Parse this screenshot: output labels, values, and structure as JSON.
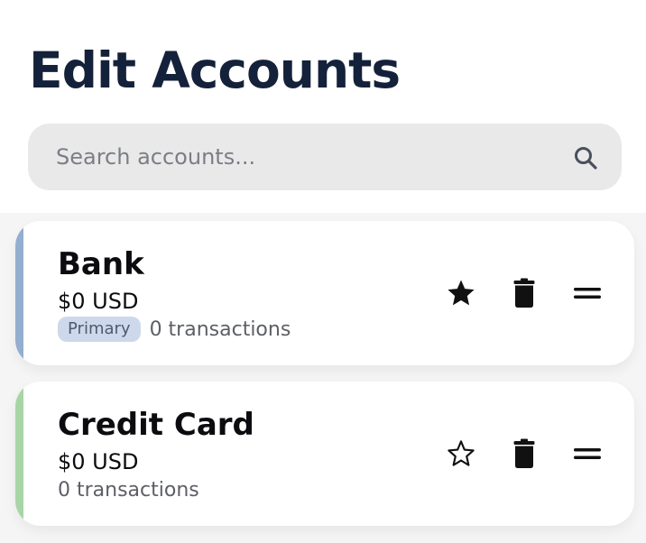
{
  "header": {
    "title": "Edit Accounts"
  },
  "search": {
    "placeholder": "Search accounts..."
  },
  "accounts": [
    {
      "name": "Bank",
      "balance": "$0 USD",
      "badge": "Primary",
      "transactions": "0 transactions",
      "color": "#93aecf",
      "favorite": true
    },
    {
      "name": "Credit Card",
      "balance": "$0 USD",
      "transactions": "0 transactions",
      "color": "#a8d5a6",
      "favorite": false
    }
  ],
  "icons": {
    "search": "search-icon",
    "favorite_filled": "star-filled-icon",
    "favorite_outline": "star-outline-icon",
    "delete": "trash-icon",
    "reorder": "drag-handle-icon"
  }
}
